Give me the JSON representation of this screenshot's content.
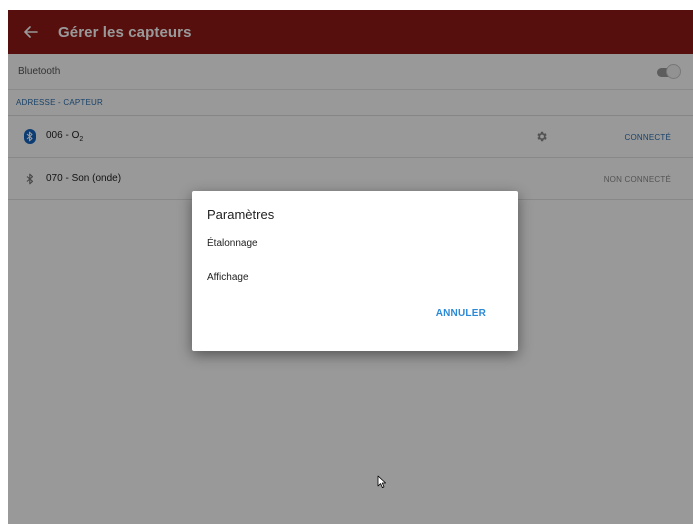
{
  "appbar": {
    "title": "Gérer les capteurs",
    "back_icon": "arrow-left-icon",
    "color": "#8f1a17"
  },
  "bluetooth": {
    "label": "Bluetooth",
    "toggle_icon": "toggle-switch-icon"
  },
  "section": {
    "header": "ADRESSE - CAPTEUR"
  },
  "sensors": [
    {
      "id": "006",
      "name_prefix": "006 - O",
      "name_sub": "2",
      "status": "CONNECTÉ",
      "icon": "bluetooth-connected-icon",
      "settings_icon": "gear-icon",
      "status_color": "#2a6fb0"
    },
    {
      "id": "070",
      "name": "070 - Son (onde)",
      "status": "NON CONNECTÉ",
      "icon": "bluetooth-icon",
      "status_color": "#8a8a8a"
    }
  ],
  "dialog": {
    "title": "Paramètres",
    "options": [
      "Étalonnage",
      "Affichage"
    ],
    "cancel_label": "ANNULER",
    "accent": "#2b8ad6"
  }
}
